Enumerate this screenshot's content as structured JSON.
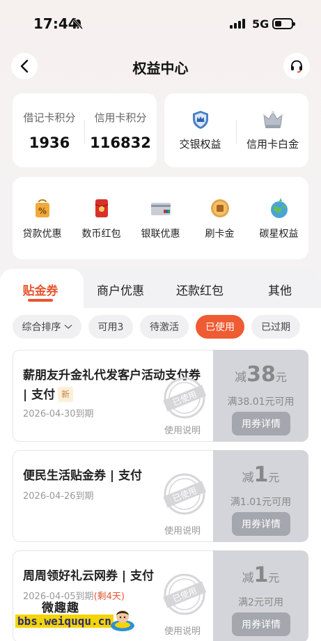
{
  "status_bar": {
    "time": "17:44",
    "network": "5G"
  },
  "header": {
    "title": "权益中心"
  },
  "points": [
    {
      "label": "借记卡积分",
      "value": "1936"
    },
    {
      "label": "信用卡积分",
      "value": "116832"
    }
  ],
  "rights": [
    {
      "label": "交银权益",
      "icon": "shield-crown-icon"
    },
    {
      "label": "信用卡白金",
      "icon": "crown-icon"
    }
  ],
  "quick_menu": [
    {
      "label": "贷款优惠",
      "icon": "percent-bag-icon"
    },
    {
      "label": "数币红包",
      "icon": "red-packet-icon"
    },
    {
      "label": "银联优惠",
      "icon": "bank-card-icon"
    },
    {
      "label": "刷卡金",
      "icon": "gold-coin-icon"
    },
    {
      "label": "碳星权益",
      "icon": "earth-icon"
    }
  ],
  "tabs": [
    {
      "label": "贴金券",
      "active": true
    },
    {
      "label": "商户优惠",
      "active": false
    },
    {
      "label": "还款红包",
      "active": false
    },
    {
      "label": "其他",
      "active": false
    }
  ],
  "filters": [
    {
      "label": "综合排序",
      "active": false
    },
    {
      "label": "可用3",
      "active": false
    },
    {
      "label": "待激活",
      "active": false
    },
    {
      "label": "已使用",
      "active": true
    },
    {
      "label": "已过期",
      "active": false
    }
  ],
  "coupons": [
    {
      "title": "薪朋友升金礼代发客户活动支付券 | 支付",
      "badge": "新",
      "date": "2026-04-30到期",
      "remain": "",
      "stamp": "已使用",
      "howto": "使用说明",
      "amount_prefix": "减",
      "amount": "38",
      "unit": "元",
      "condition": "满38.01元可用",
      "detail": "用券详情"
    },
    {
      "title": "便民生活贴金券 | 支付",
      "badge": "",
      "date": "2026-04-26到期",
      "remain": "",
      "stamp": "已使用",
      "howto": "使用说明",
      "amount_prefix": "减",
      "amount": "1",
      "unit": "元",
      "condition": "满1.01元可用",
      "detail": "用券详情"
    },
    {
      "title": "周周领好礼云网券 | 支付",
      "badge": "",
      "date": "2026-04-05到期",
      "remain": "(剩4天)",
      "stamp": "已使用",
      "howto": "使用说明",
      "amount_prefix": "减",
      "amount": "1",
      "unit": "元",
      "condition": "满2元可用",
      "detail": "用券详情"
    }
  ],
  "watermark": {
    "top": "微趣趣",
    "url": "bbs.weiququ.cn"
  },
  "colors": {
    "accent": "#ef5b32",
    "tab_active": "#e8542e",
    "coupon_right_bg": "#d4d5da"
  }
}
